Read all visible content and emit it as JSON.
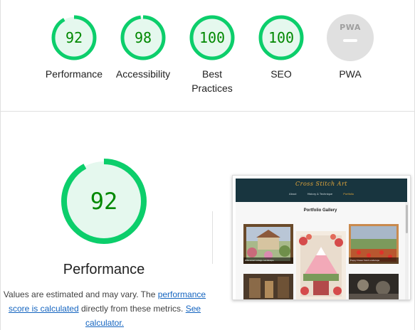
{
  "summary": {
    "gauges": [
      {
        "score": "92",
        "label": "Performance"
      },
      {
        "score": "98",
        "label": "Accessibility"
      },
      {
        "score": "100",
        "label": "Best Practices"
      },
      {
        "score": "100",
        "label": "SEO"
      }
    ],
    "pwa": {
      "badge_text": "PWA",
      "label": "PWA"
    }
  },
  "detail": {
    "score": "92",
    "title": "Performance",
    "note_prefix": "Values are estimated and may vary. The ",
    "note_link1": "performance score is calculated",
    "note_middle": " directly from these metrics. ",
    "note_link2": "See calculator."
  },
  "thumbnail": {
    "site_title": "Cross Stitch Art",
    "nav": [
      "About",
      "History & Technique",
      "Portfolio"
    ],
    "active_nav": "Portfolio",
    "heading": "Portfolio Gallery",
    "captions": [
      "Whimsical Cottage Landscape",
      "Poppy Flower Field Landscape"
    ]
  },
  "colors": {
    "pass_green": "#0cce6b",
    "pass_text": "#008800",
    "pass_fill": "#e5f8ee",
    "pwa_gray": "#e0e0e0",
    "link_blue": "#1565c0",
    "site_header": "#18353f"
  }
}
